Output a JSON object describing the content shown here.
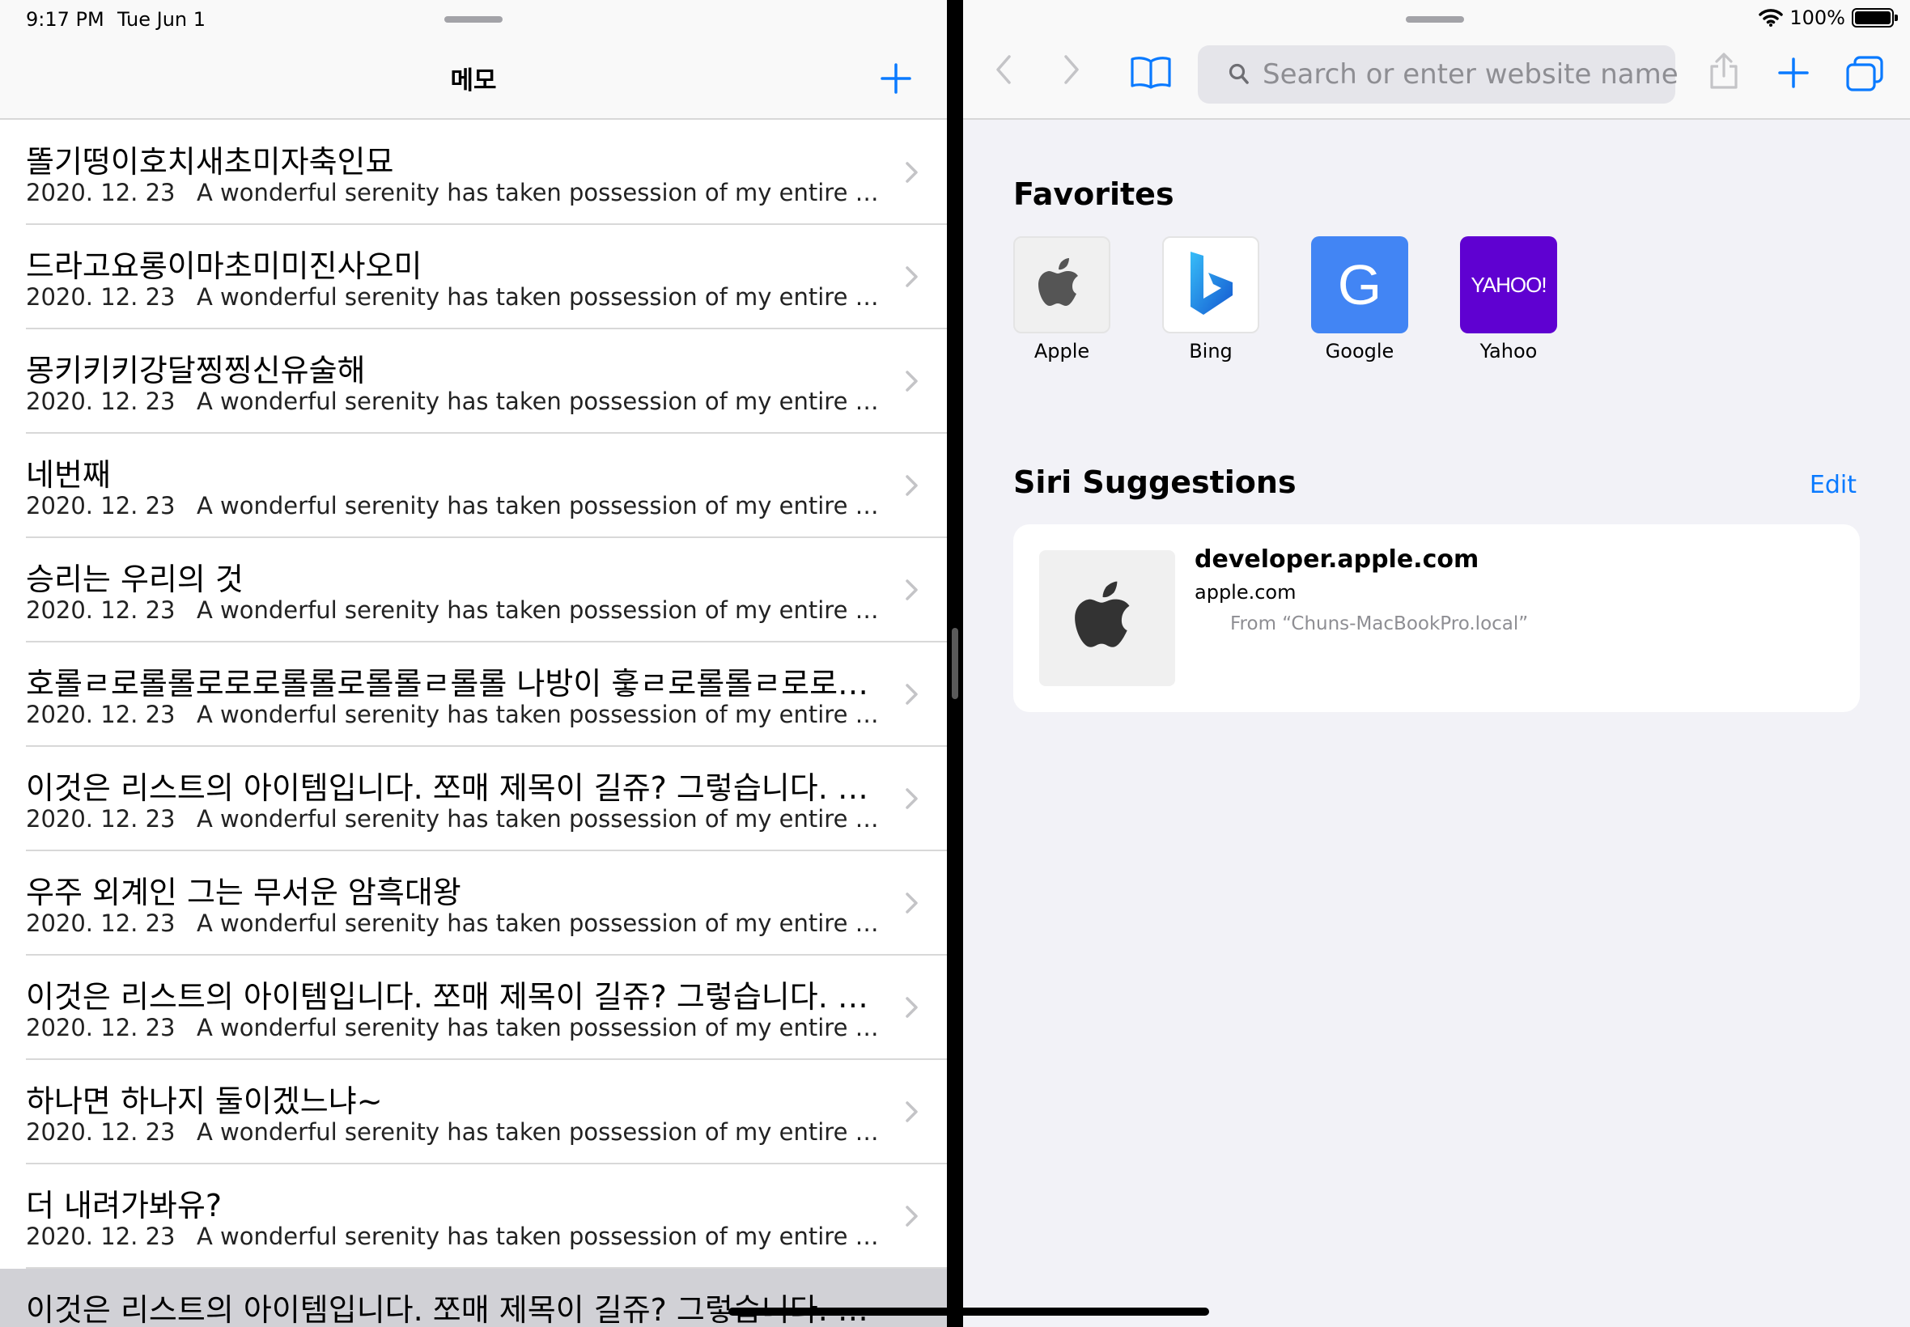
{
  "status": {
    "time": "9:17 PM",
    "date": "Tue Jun 1",
    "battery": "100%"
  },
  "memo": {
    "nav_title": "메모",
    "rows": [
      {
        "title": "똘기떵이호치새초미자축인묘",
        "date": "2020. 12. 23",
        "preview": "A wonderful serenity has taken possession of my entire soul,..."
      },
      {
        "title": "드라고요롱이마초미미진사오미",
        "date": "2020. 12. 23",
        "preview": "A wonderful serenity has taken possession of my entire soul,..."
      },
      {
        "title": "몽키키키강달찡찡신유술해",
        "date": "2020. 12. 23",
        "preview": "A wonderful serenity has taken possession of my entire soul,..."
      },
      {
        "title": "네번째",
        "date": "2020. 12. 23",
        "preview": "A wonderful serenity has taken possession of my entire soul,..."
      },
      {
        "title": "승리는 우리의 것",
        "date": "2020. 12. 23",
        "preview": "A wonderful serenity has taken possession of my entire soul,..."
      },
      {
        "title": "호롤ㄹ로롤롤로로로롤롤로롤롤ㄹ롤롤 나방이 훟ㄹ로롤롤ㄹ로로로…",
        "date": "2020. 12. 23",
        "preview": "A wonderful serenity has taken possession of my entire soul,..."
      },
      {
        "title": "이것은 리스트의 아이템입니다. 쪼매 제목이 길쥬? 그렇습니다. 그…",
        "date": "2020. 12. 23",
        "preview": "A wonderful serenity has taken possession of my entire soul,..."
      },
      {
        "title": "우주 외계인 그는 무서운 암흑대왕",
        "date": "2020. 12. 23",
        "preview": "A wonderful serenity has taken possession of my entire soul,..."
      },
      {
        "title": "이것은 리스트의 아이템입니다. 쪼매 제목이 길쥬? 그렇습니다. 그…",
        "date": "2020. 12. 23",
        "preview": "A wonderful serenity has taken possession of my entire soul,..."
      },
      {
        "title": "하나면 하나지 둘이겠느냐~",
        "date": "2020. 12. 23",
        "preview": "A wonderful serenity has taken possession of my entire soul,..."
      },
      {
        "title": "더 내려가봐유?",
        "date": "2020. 12. 23",
        "preview": "A wonderful serenity has taken possession of my entire soul,..."
      },
      {
        "title": "이것은 리스트의 아이템입니다. 쪼매 제목이 길쥬? 그렇습니다. 그…",
        "date": "",
        "preview": ""
      }
    ]
  },
  "safari": {
    "search_placeholder": "Search or enter website name",
    "favorites_title": "Favorites",
    "favorites": [
      {
        "label": "Apple",
        "icon": "apple-logo-icon"
      },
      {
        "label": "Bing",
        "icon": "bing-logo-icon"
      },
      {
        "label": "Google",
        "icon": "google-logo-icon",
        "glyph": "G"
      },
      {
        "label": "Yahoo",
        "icon": "yahoo-logo-icon",
        "glyph": "YAHOO!"
      }
    ],
    "siri_title": "Siri Suggestions",
    "edit_label": "Edit",
    "suggestion": {
      "title": "developer.apple.com",
      "domain": "apple.com",
      "from": "From “Chuns-MacBookPro.local”"
    }
  },
  "colors": {
    "accent": "#0a7aff",
    "google_blue": "#4285f4",
    "yahoo_purple": "#5f01d1",
    "selected_row": "#d1d1d6"
  }
}
